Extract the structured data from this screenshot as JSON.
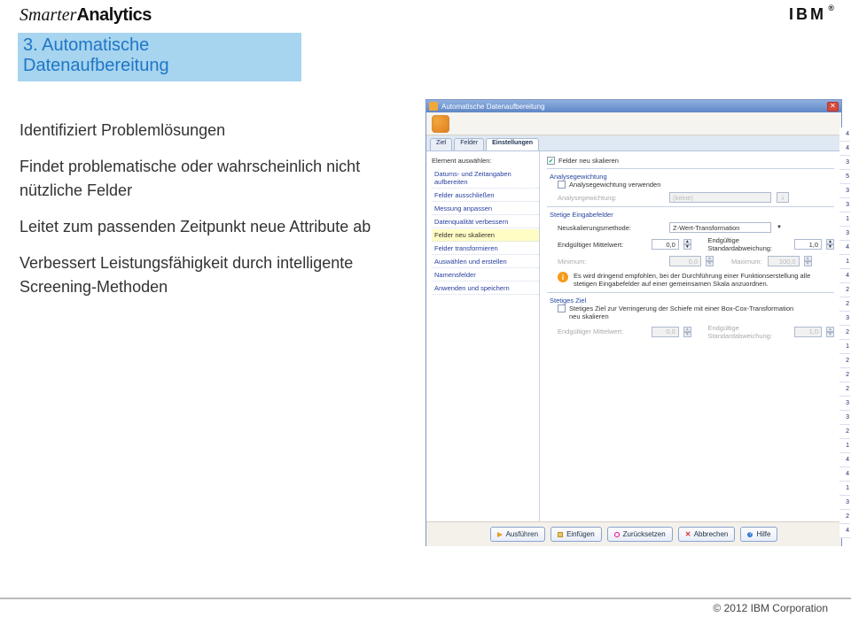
{
  "brand": {
    "part1": "Smarter",
    "part2": "Analytics"
  },
  "ibm": "IBM",
  "section_title": "3. Automatische Datenaufbereitung",
  "bullets": {
    "b1": "Identifiziert Problemlösungen",
    "b2": "Findet problematische oder wahrscheinlich nicht nützliche Felder",
    "b3": "Leitet zum passenden Zeitpunkt neue Attribute ab",
    "b4": "Verbessert Leistungsfähigkeit durch intelligente Screening-Methoden"
  },
  "dialog": {
    "title": "Automatische Datenaufbereitung",
    "tabs": {
      "t1": "Ziel",
      "t2": "Felder",
      "t3": "Einstellungen"
    },
    "left_title": "Element auswählen:",
    "left": {
      "i1": "Datums- und Zeitangaben aufbereiten",
      "i2": "Felder ausschließen",
      "i3": "Messung anpassen",
      "i4": "Datenqualität verbessern",
      "i5": "Felder neu skalieren",
      "i6": "Felder transformieren",
      "i7": "Auswählen und erstellen",
      "i8": "Namensfelder",
      "i9": "Anwenden und speichern"
    },
    "chk1": "Felder neu skalieren",
    "fs1": "Analysegewichtung",
    "chk2": "Analysegewichtung verwenden",
    "weight_label": "Analysegewichtung:",
    "weight_value": "(keine)",
    "fs2": "Stetige Eingabefelder",
    "method_label": "Neuskalierungsmethode:",
    "method_value": "Z-Wert-Transformation",
    "mean_label": "Endgültiger Mittelwert:",
    "mean_value": "0,0",
    "std_label": "Endgültige Standardabweichung:",
    "std_value": "1,0",
    "min_label": "Minimum:",
    "min_value": "0,0",
    "max_label": "Maximum:",
    "max_value": "100,0",
    "info": "Es wird dringend empfohlen, bei der Durchführung einer Funktionserstellung alle stetigen Eingabefelder auf einer gemeinsamen Skala anzuordnen.",
    "fs3": "Stetiges Ziel",
    "target_chk": "Stetiges Ziel zur Verringerung der Schiefe mit einer Box-Cox-Transformation neu skalieren",
    "t_mean_label": "Endgültiger Mittelwert:",
    "t_mean_value": "0,0",
    "t_std_label": "Endgültige Standardabweichung:",
    "t_std_value": "1,0",
    "buttons": {
      "run": "Ausführen",
      "paste": "Einfügen",
      "reset": "Zurücksetzen",
      "cancel": "Abbrechen",
      "help": "Hilfe"
    }
  },
  "edge_numbers": [
    "4",
    "4",
    "3",
    "5",
    "3",
    "3",
    "1",
    "3",
    "4",
    "1",
    "4",
    "2",
    "2",
    "3",
    "2",
    "1",
    "2",
    "2",
    "2",
    "3",
    "3",
    "2",
    "1",
    "4",
    "4",
    "1",
    "3",
    "2",
    "4"
  ],
  "footer": "© 2012 IBM Corporation"
}
